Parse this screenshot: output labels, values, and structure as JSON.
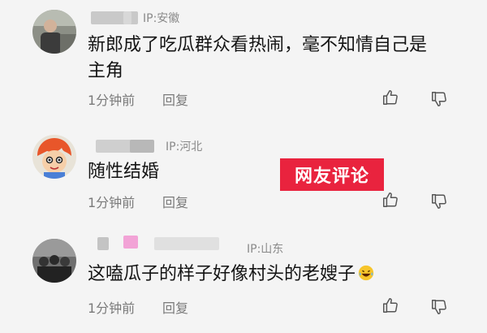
{
  "tag": {
    "label": "网友评论"
  },
  "comments": [
    {
      "ip": "IP:安徽",
      "text": "新郎成了吃瓜群众看热闹，毫不知情自己是主角",
      "time": "1分钟前",
      "reply": "回复",
      "avatar_icon": "person-photo-icon"
    },
    {
      "ip": "IP:河北",
      "text": "随性结婚",
      "time": "1分钟前",
      "reply": "回复",
      "avatar_icon": "cartoon-kid-icon"
    },
    {
      "ip": "IP:山东",
      "text": "这嗑瓜子的样子好像村头的老嫂子",
      "time": "1分钟前",
      "reply": "回复",
      "avatar_icon": "group-photo-icon",
      "emoji": "laughing-tears-emoji-icon"
    }
  ],
  "colors": {
    "accent": "#e9233e",
    "background": "#f4f4f4",
    "meta_text": "#7a7a7a"
  }
}
